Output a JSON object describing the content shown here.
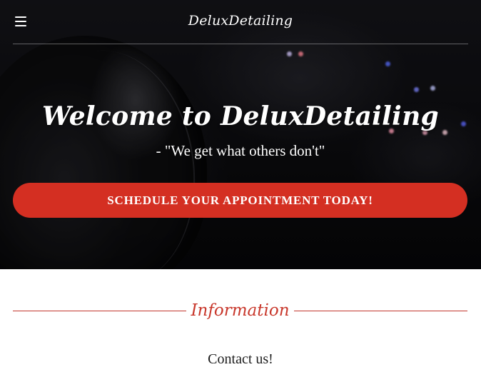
{
  "header": {
    "brand": "DeluxDetailing",
    "menu_icon": "hamburger-menu-icon"
  },
  "hero": {
    "title": "Welcome to DeluxDetailing",
    "subtitle": "- \"We get what others don't\"",
    "cta_label": "SCHEDULE YOUR APPOINTMENT TODAY!"
  },
  "information": {
    "heading": "Information",
    "contact_text": "Contact us!"
  },
  "colors": {
    "accent": "#d42f22",
    "heading_accent": "#c8372b",
    "hero_background": "#0b0b0d",
    "text_light": "#ffffff",
    "text_dark": "#1c1c1c"
  }
}
